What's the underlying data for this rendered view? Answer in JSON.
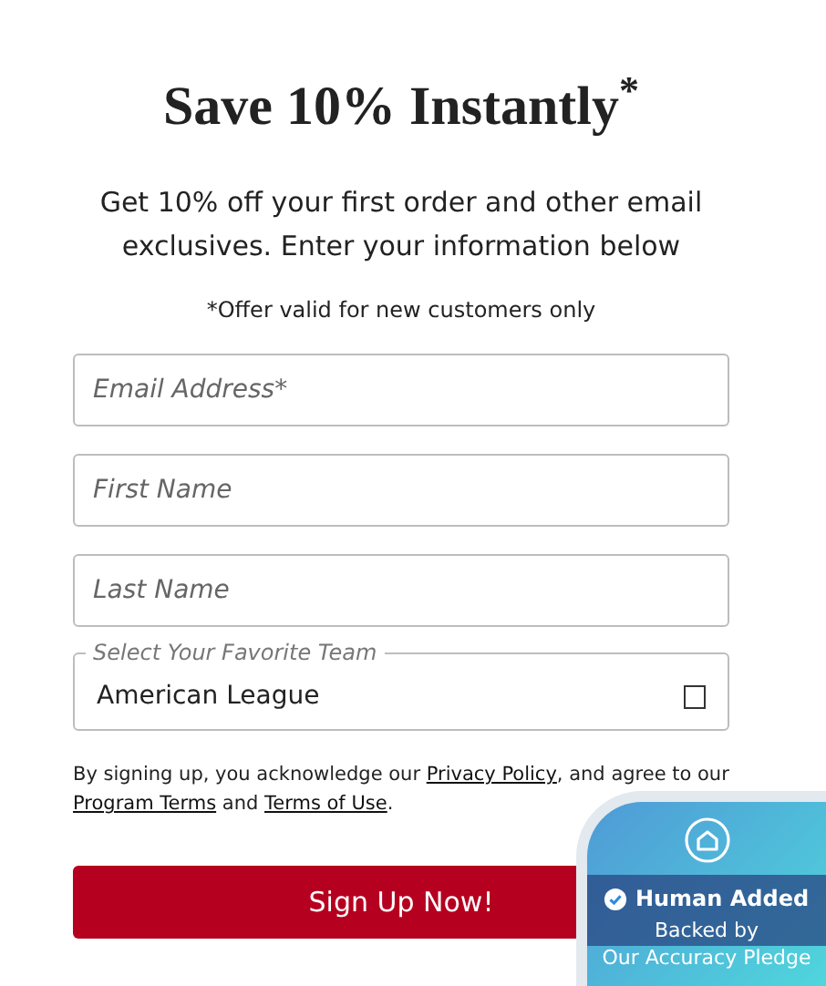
{
  "heading": "Save 10% Instantly$^{*}$",
  "intro": "Get 10% off your first order and other email exclusives. Enter your information below",
  "offer_note": "*Offer valid for new customers only",
  "fields": [
    {
      "kind": "text",
      "placeholder": "Email Address*"
    },
    {
      "kind": "text",
      "placeholder": "First Name"
    },
    {
      "kind": "text",
      "placeholder": "Last Name"
    },
    {
      "kind": "select",
      "label": "Select Your Favorite Team",
      "value": "American League"
    }
  ],
  "legal": [
    {
      "kind": "text",
      "text": "By signing up, you acknowledge our "
    },
    {
      "kind": "link",
      "text": "Privacy Policy"
    },
    {
      "kind": "text",
      "text": ", and agree to our "
    },
    {
      "kind": "link",
      "text": "Program Terms"
    },
    {
      "kind": "text",
      "text": " and "
    },
    {
      "kind": "link",
      "text": "Terms of Use"
    },
    {
      "kind": "text",
      "text": "."
    }
  ],
  "submit_button": "Sign Up Now!",
  "badge": {
    "title": "Human Added",
    "subtitle": "Backed by",
    "subtitle_2": "Our Accuracy Pledge"
  }
}
